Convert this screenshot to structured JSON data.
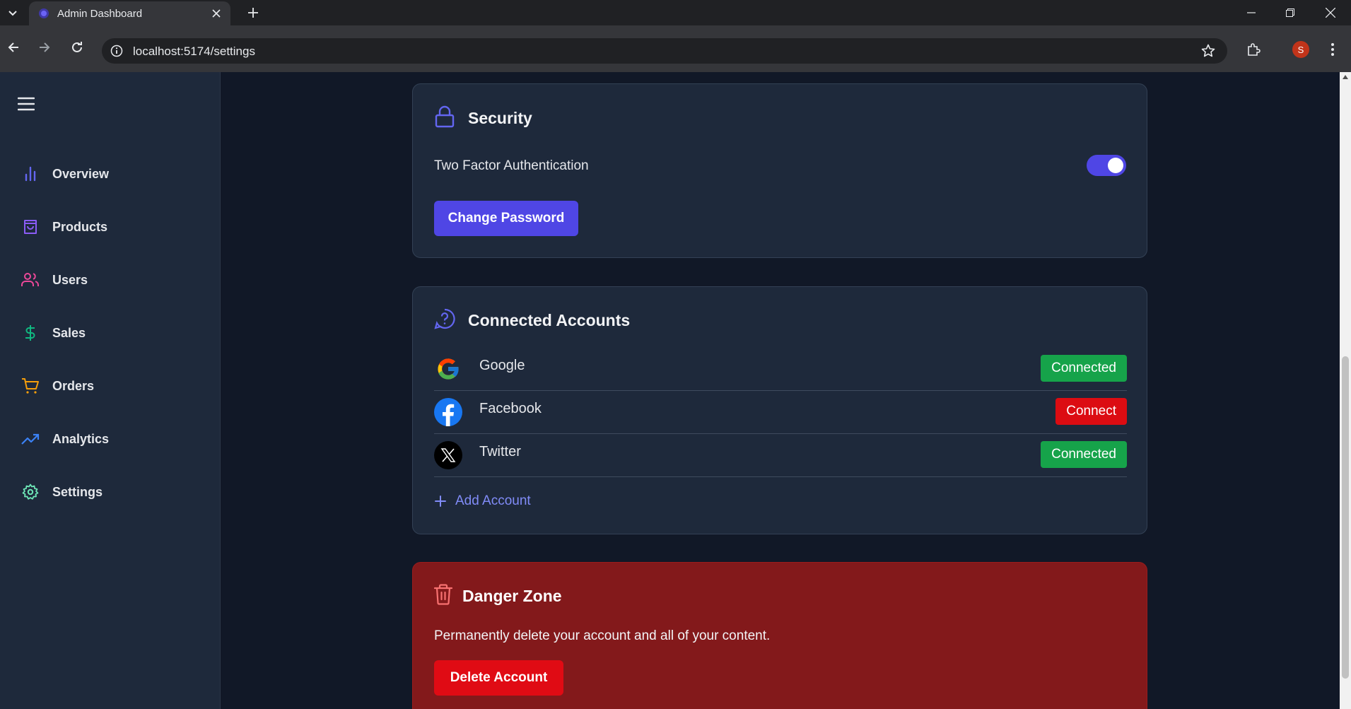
{
  "browser": {
    "tab_title": "Admin Dashboard",
    "url": "localhost:5174/settings",
    "profile_initial": "S"
  },
  "sidebar": {
    "items": [
      {
        "label": "Overview",
        "icon": "bar-chart-icon",
        "color": "#6366f1"
      },
      {
        "label": "Products",
        "icon": "shopping-bag-icon",
        "color": "#8b5cf6"
      },
      {
        "label": "Users",
        "icon": "users-icon",
        "color": "#ec4899"
      },
      {
        "label": "Sales",
        "icon": "dollar-sign-icon",
        "color": "#10b981"
      },
      {
        "label": "Orders",
        "icon": "shopping-cart-icon",
        "color": "#f59e0b"
      },
      {
        "label": "Analytics",
        "icon": "trending-up-icon",
        "color": "#3b82f6"
      },
      {
        "label": "Settings",
        "icon": "settings-icon",
        "color": "#6ee7b7"
      }
    ]
  },
  "security": {
    "title": "Security",
    "two_factor_label": "Two Factor Authentication",
    "two_factor_enabled": true,
    "change_password_label": "Change Password"
  },
  "connected_accounts": {
    "title": "Connected Accounts",
    "accounts": [
      {
        "name": "Google",
        "status": "Connected"
      },
      {
        "name": "Facebook",
        "status": "Connect"
      },
      {
        "name": "Twitter",
        "status": "Connected"
      }
    ],
    "add_account_label": "Add Account"
  },
  "danger_zone": {
    "title": "Danger Zone",
    "description": "Permanently delete your account and all of your content.",
    "delete_label": "Delete Account"
  },
  "colors": {
    "accent": "#4f46e5",
    "connected": "#16a34a",
    "connect": "#dc0c12",
    "danger_bg": "#83191b"
  }
}
